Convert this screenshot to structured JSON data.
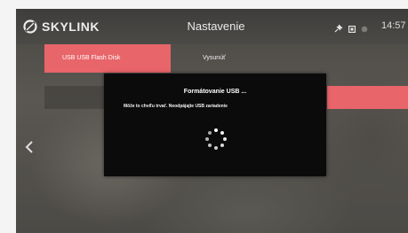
{
  "header": {
    "brand": "SKYLINK",
    "title": "Nastavenie",
    "clock": "14:57"
  },
  "menu": {
    "items": [
      {
        "label": "USB USB Flash Disk",
        "active": true
      },
      {
        "label": "Vysunúť",
        "active": false
      }
    ]
  },
  "dialog": {
    "title": "Formátovanie USB ...",
    "message": "Môže to chvíľu trvať. Neodpájajte USB zariadenie"
  },
  "icons": {
    "logo": "skylink-logo-icon",
    "status": [
      "satellite-icon",
      "record-icon",
      "standby-icon"
    ],
    "back": "chevron-left-icon",
    "loading": "loading-spinner-icon"
  },
  "colors": {
    "accent": "#e8656a",
    "topbar": "#444341",
    "dialog_bg": "#0b0b0b"
  }
}
